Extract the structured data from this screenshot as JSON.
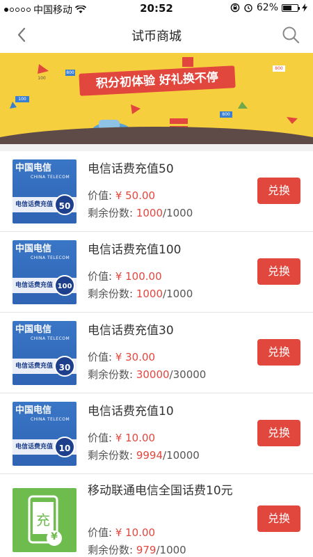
{
  "status_bar": {
    "carrier": "中国移动",
    "time": "20:52",
    "battery": "62%",
    "battery_level": 0.62,
    "icons": [
      "signal-dots-icon",
      "wifi-icon",
      "rotation-lock-icon",
      "alarm-icon",
      "battery-icon",
      "charging-icon"
    ]
  },
  "navbar": {
    "title": "试币商城",
    "back_icon": "chevron-left-icon",
    "search_icon": "search-icon"
  },
  "banner": {
    "slogan": "积分初体验 好礼换不停",
    "tags": [
      "800",
      "800",
      "100",
      "100",
      "800"
    ],
    "colors": {
      "background": "#f6cf3e",
      "ribbon": "#e2473e"
    }
  },
  "list": {
    "price_label": "价值: ",
    "stock_label": "剩余份数: ",
    "button_label": "兑换",
    "items": [
      {
        "name": "电信话费充值50",
        "price": "¥ 50.00",
        "remaining": "1000",
        "total": "/1000",
        "thumb_strip": "电信话费充值",
        "thumb_badge": "50",
        "thumb_logo": "中国电信",
        "thumb_logo_en": "CHINA TELECOM"
      },
      {
        "name": "电信话费充值100",
        "price": "¥ 100.00",
        "remaining": "1000",
        "total": "/1000",
        "thumb_strip": "电信话费充值",
        "thumb_badge": "100",
        "thumb_logo": "中国电信",
        "thumb_logo_en": "CHINA TELECOM"
      },
      {
        "name": "电信话费充值30",
        "price": "¥ 30.00",
        "remaining": "30000",
        "total": "/30000",
        "thumb_strip": "电信话费充值",
        "thumb_badge": "30",
        "thumb_logo": "中国电信",
        "thumb_logo_en": "CHINA TELECOM"
      },
      {
        "name": "电信话费充值10",
        "price": "¥ 10.00",
        "remaining": "9994",
        "total": "/10000",
        "thumb_strip": "电信话费充值",
        "thumb_badge": "10",
        "thumb_logo": "中国电信",
        "thumb_logo_en": "CHINA TELECOM"
      },
      {
        "name": "移动联通电信全国话费10元",
        "price": "¥ 10.00",
        "remaining": "979",
        "total": "/1000",
        "thumb_text": "充",
        "thumb_yen": "¥"
      }
    ]
  },
  "colors": {
    "accent": "#e2473e",
    "divider": "#e2e2e2"
  }
}
